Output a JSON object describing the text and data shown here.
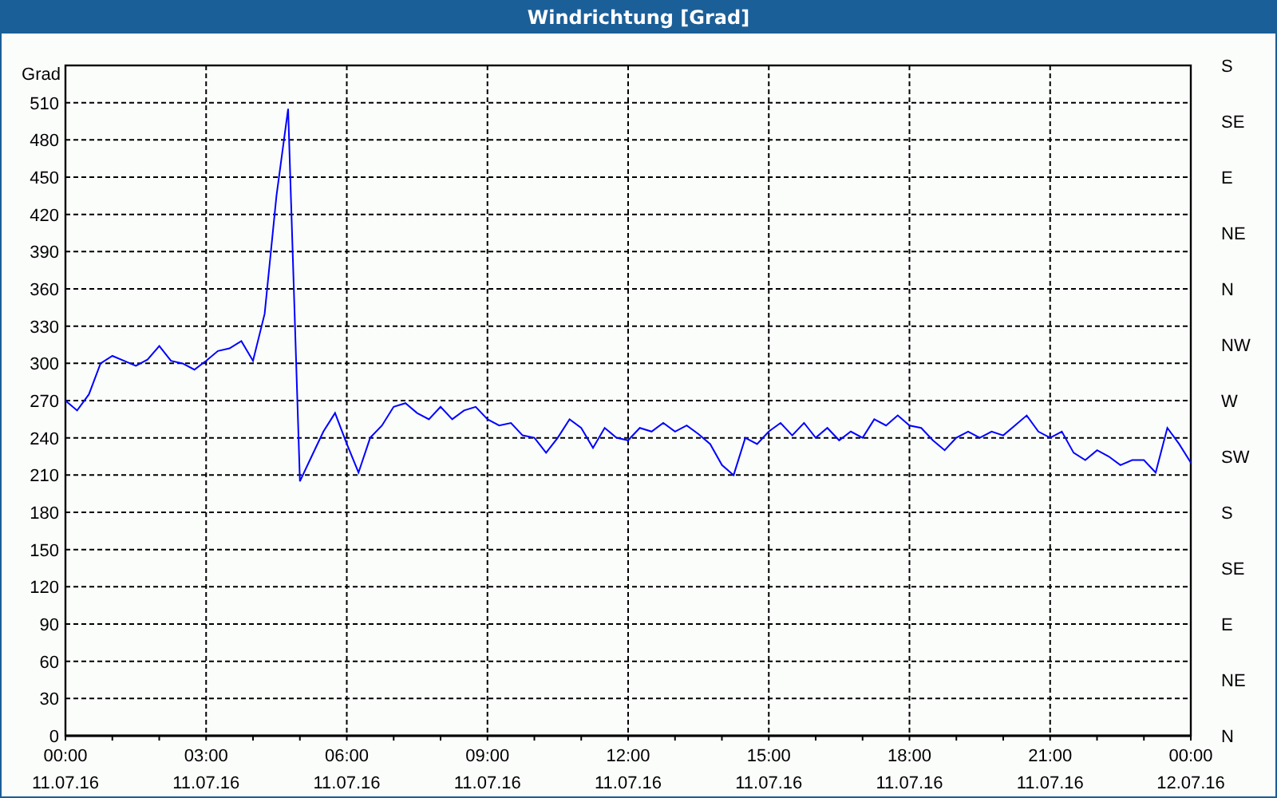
{
  "window": {
    "title": "Windrichtung [Grad]"
  },
  "chart": {
    "chart_data": {
      "type": "line",
      "grid": true,
      "ylabel": "Grad",
      "ylim": [
        0,
        540
      ],
      "yticks": [
        0,
        30,
        60,
        90,
        120,
        150,
        180,
        210,
        240,
        270,
        300,
        330,
        360,
        390,
        420,
        450,
        480,
        510
      ],
      "categories": [
        "00:00 11.07.16",
        null,
        null,
        null,
        null,
        null,
        null,
        null,
        null,
        null,
        null,
        null,
        "03:00 11.07.16",
        null,
        null,
        null,
        null,
        null,
        null,
        null,
        null,
        null,
        null,
        null,
        "06:00 11.07.16",
        null,
        null,
        null,
        null,
        null,
        null,
        null,
        null,
        null,
        null,
        null,
        "09:00 11.07.16",
        null,
        null,
        null,
        null,
        null,
        null,
        null,
        null,
        null,
        null,
        null,
        "12:00 11.07.16",
        null,
        null,
        null,
        null,
        null,
        null,
        null,
        null,
        null,
        null,
        null,
        "15:00 11.07.16",
        null,
        null,
        null,
        null,
        null,
        null,
        null,
        null,
        null,
        null,
        null,
        "18:00 11.07.16",
        null,
        null,
        null,
        null,
        null,
        null,
        null,
        null,
        null,
        null,
        null,
        "21:00 11.07.16",
        null,
        null,
        null,
        null,
        null,
        null,
        null,
        null,
        null,
        null,
        null,
        "00:00 12.07.16"
      ],
      "series": [
        {
          "color": "#0000ff",
          "values": [
            270,
            262,
            275,
            300,
            306,
            302,
            298,
            303,
            314,
            302,
            300,
            295,
            302,
            310,
            312,
            318,
            302,
            340,
            435,
            505,
            205,
            225,
            245,
            260,
            235,
            212,
            240,
            250,
            265,
            268,
            260,
            255,
            265,
            255,
            262,
            265,
            255,
            250,
            252,
            242,
            240,
            228,
            240,
            255,
            248,
            232,
            248,
            240,
            238,
            248,
            245,
            252,
            245,
            250,
            243,
            235,
            218,
            210,
            240,
            235,
            245,
            252,
            242,
            252,
            240,
            248,
            238,
            245,
            240,
            255,
            250,
            258,
            250,
            248,
            238,
            230,
            240,
            245,
            240,
            245,
            242,
            250,
            258,
            245,
            240,
            245,
            228,
            222,
            230,
            225,
            218,
            222,
            222,
            212,
            248,
            235,
            220
          ]
        }
      ]
    },
    "right_axis": {
      "labels": [
        "S",
        "SE",
        "E",
        "NE",
        "N",
        "NW",
        "W",
        "SW",
        "S",
        "SE",
        "E",
        "NE",
        "N"
      ]
    }
  }
}
